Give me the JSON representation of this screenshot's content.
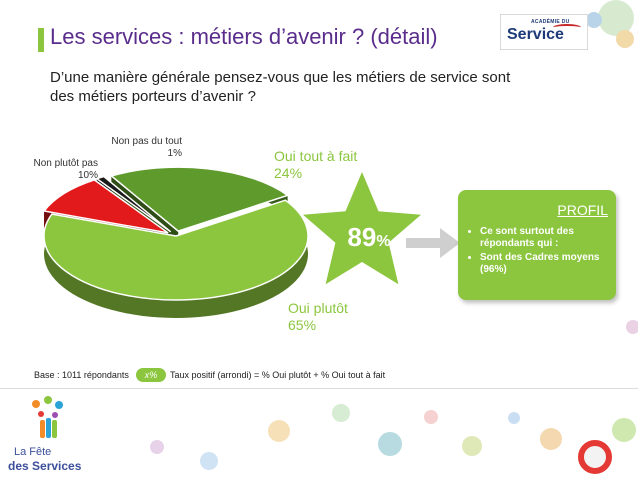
{
  "title": "Les services : métiers d’avenir ? (détail)",
  "question": "D’une manière générale pensez-vous que les métiers de service sont des métiers porteurs d’avenir ?",
  "logo": {
    "small": "ACADÉMIE DU",
    "main": "Service"
  },
  "chart_data": {
    "type": "pie",
    "style": "3d",
    "slices": [
      {
        "label": "Oui tout à fait",
        "value": 24,
        "value_label": "24%",
        "color": "#5e9a2c"
      },
      {
        "label": "Oui plutôt",
        "value": 65,
        "value_label": "65%",
        "color": "#8cc63f"
      },
      {
        "label": "Non plutôt pas",
        "value": 10,
        "value_label": "10%",
        "color": "#e31a1c"
      },
      {
        "label": "Non pas du tout",
        "value": 1,
        "value_label": "1%",
        "color": "#1a1a1a"
      }
    ],
    "highlight": {
      "value": "89",
      "unit": "%"
    }
  },
  "profile": {
    "title": "PROFIL",
    "bullets": [
      "Ce sont surtout des répondants qui :",
      "Sont des Cadres moyens (96%)"
    ]
  },
  "footer": {
    "base": "Base : 1011 répondants",
    "pill": "x%",
    "formula": "Taux positif (arrondi) = % Oui plutôt + % Oui tout à fait"
  },
  "brand": {
    "line1": "La Fête",
    "line2": "des Services"
  },
  "colors": {
    "title": "#5a2d8c",
    "accent": "#8cc63f",
    "dark_green": "#5e9a2c",
    "red": "#e31a1c",
    "arrow": "#cfcfcf"
  }
}
